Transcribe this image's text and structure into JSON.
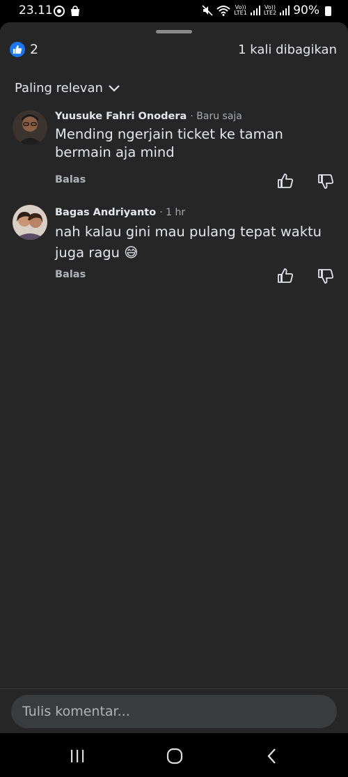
{
  "status_bar": {
    "time": "23.11",
    "battery": "90%",
    "lte1": "LTE1",
    "lte2": "LTE2",
    "volte": "Vo))"
  },
  "header": {
    "like_count": "2",
    "shares": "1 kali dibagikan"
  },
  "sort": {
    "label": "Paling relevan"
  },
  "comments": [
    {
      "author": "Yuusuke Fahri Onodera",
      "time": "· Baru saja",
      "text": "Mending ngerjain ticket ke taman bermain aja mind",
      "reply": "Balas"
    },
    {
      "author": "Bagas Andriyanto",
      "time": "· 1 hr",
      "text": "nah kalau gini mau pulang tepat waktu juga ragu 😅",
      "reply": "Balas"
    }
  ],
  "composer": {
    "placeholder": "Tulis komentar..."
  },
  "colors": {
    "sheet_bg": "#262626",
    "like_blue": "#1877f2",
    "input_bg": "#3a3b3c"
  }
}
